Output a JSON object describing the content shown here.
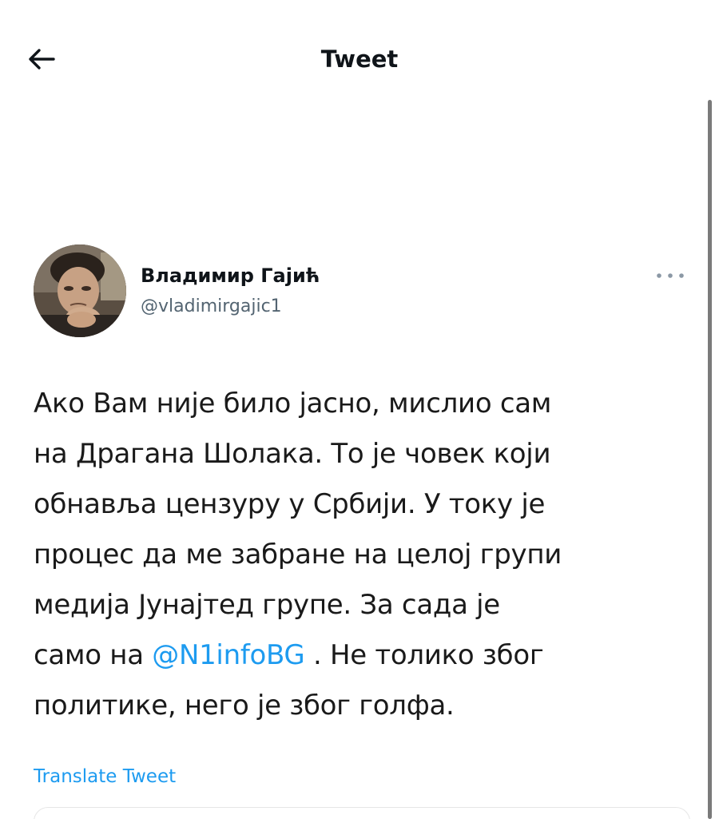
{
  "header": {
    "title": "Tweet",
    "back_icon": "arrow-left-icon"
  },
  "author": {
    "name": "Владимир Гајић",
    "handle": "@vladimirgajic1",
    "more_icon": "more-dots-icon"
  },
  "tweet": {
    "lines": [
      {
        "text": "Ако Вам није било јасно, мислио сам"
      },
      {
        "text": "на Драгана Шолака. То је човек који"
      },
      {
        "text": "обнавља цензуру у Србији. У току је"
      },
      {
        "text": "процес да ме забране на целој групи"
      },
      {
        "text": "медија Јунајтед групе. За сада је"
      },
      {
        "before": "само на ",
        "mention": "@N1infoBG",
        "after": " . Не толико због"
      },
      {
        "text": "политике, него је због голфа."
      }
    ]
  },
  "actions": {
    "translate_label": "Translate Tweet"
  },
  "colors": {
    "link": "#1d9bf0",
    "secondary_text": "#536471",
    "primary_text": "#0f1419"
  }
}
